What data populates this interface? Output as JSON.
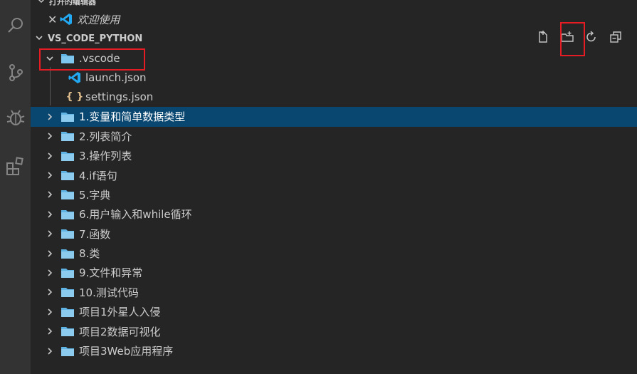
{
  "open_editors": {
    "header_label": "打开的编辑器",
    "items": [
      {
        "label": "欢迎使用"
      }
    ]
  },
  "folder": {
    "name": "VS_CODE_PYTHON",
    "toolbar": {
      "new_file": "new-file-icon",
      "new_folder": "new-folder-icon",
      "refresh": "refresh-icon",
      "collapse": "collapse-all-icon"
    }
  },
  "tree": {
    "vscode_folder": ".vscode",
    "vscode_children": [
      "launch.json",
      "settings.json"
    ],
    "folders": [
      "1.变量和简单数据类型",
      "2.列表简介",
      "3.操作列表",
      "4.if语句",
      "5.字典",
      "6.用户输入和while循环",
      "7.函数",
      "8.类",
      "9.文件和异常",
      "10.测试代码",
      "项目1外星人入侵",
      "项目2数据可视化",
      "项目3Web应用程序"
    ],
    "selected_index": 0
  },
  "colors": {
    "selection": "#094771",
    "folder": "#5fb4e4",
    "highlight": "#e51c23",
    "vscode_blue": "#23a9f2"
  }
}
